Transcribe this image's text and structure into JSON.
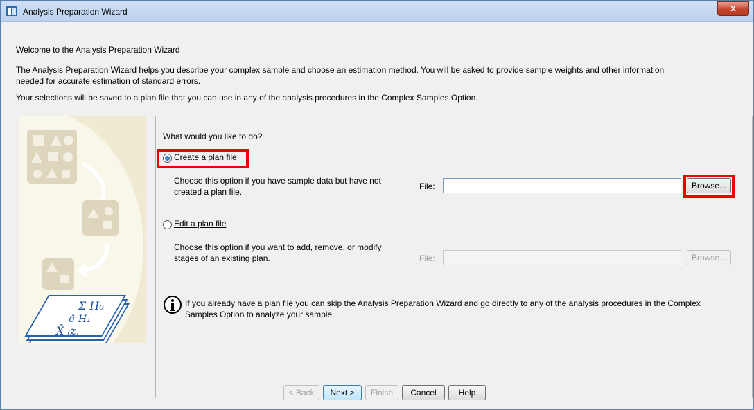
{
  "window": {
    "title": "Analysis Preparation Wizard",
    "close_glyph": "x"
  },
  "intro": {
    "heading": "Welcome to the Analysis Preparation Wizard",
    "line1": "The Analysis Preparation Wizard helps you describe your complex sample and choose an estimation method. You will be asked to provide sample weights and other information",
    "line2": "needed for accurate estimation of standard errors.",
    "line3": "Your selections will be saved to a plan file that you can use in any of the analysis procedures in the Complex Samples Option."
  },
  "panel": {
    "question": "What would you like to do?",
    "create": {
      "label": "Create a plan file",
      "selected": true,
      "desc1": "Choose this option if you have sample data but have not",
      "desc2": "created a plan file.",
      "file_label": "File:",
      "file_value": "",
      "browse": "Browse..."
    },
    "edit": {
      "label": "Edit a plan file",
      "selected": false,
      "desc1": "Choose this option if you want to add, remove, or modify",
      "desc2": "stages of an existing plan.",
      "file_label": "File:",
      "file_value": "",
      "browse": "Browse..."
    },
    "info1": "If you already have a plan file you can skip the Analysis Preparation Wizard and go directly to any of the analysis procedures in the Complex",
    "info2": "Samples Option to analyze your sample.",
    "info_icon": "info-icon"
  },
  "buttons": {
    "back": "< Back",
    "next": "Next >",
    "finish": "Finish",
    "cancel": "Cancel",
    "help": "Help"
  },
  "colors": {
    "highlight": "#ee0000",
    "illustration_bg": "#f1ead3"
  }
}
